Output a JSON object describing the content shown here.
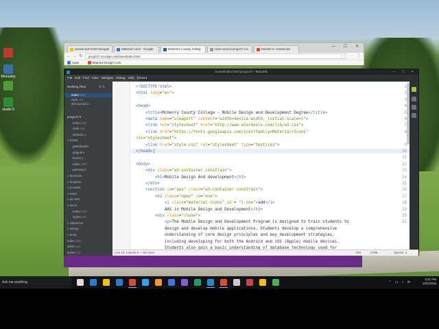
{
  "colors": {
    "accent": "#2b87d3",
    "editor_bg": "#2e3134",
    "purple_bar": "#6a2a8a"
  },
  "desktop": {
    "icons": [
      {
        "label": "",
        "color": "#c0392b"
      },
      {
        "label": "Recovery",
        "color": "#3d6ea8"
      },
      {
        "label": "",
        "color": "#4f9c38"
      },
      {
        "label": "studio 5",
        "color": "#2f8c36"
      }
    ]
  },
  "browser": {
    "tabs": [
      {
        "label": "JavaScript DOM Navigati",
        "fav": "#f2c200"
      },
      {
        "label": "Material Icons - Google",
        "fav": "#2d7bd6"
      },
      {
        "label": "McHenry County Colleg",
        "fav": "#1e5ea3",
        "active": true
      },
      {
        "label": "view-source:prog147.mc",
        "fav": "#999999"
      },
      {
        "label": "Module 5: JavaScript",
        "fav": "#e04a2e"
      }
    ],
    "address": "prog147.mccdgm.net/sixes/index.html",
    "bookmarks": [
      {
        "label": "Apps",
        "fav": "#3b78e7"
      },
      {
        "label": "Material Design Colo",
        "fav": "#e8453c"
      }
    ]
  },
  "editor": {
    "title": "boxes/index.html (prog147) - Brackets",
    "menu": [
      "File",
      "Edit",
      "Find",
      "View",
      "Navigate",
      "Debug",
      "Help",
      "Emmet"
    ],
    "sidebar": {
      "working_files_title": "Working Files",
      "working_files": [
        {
          "name": "index",
          "ext": ".html",
          "active": true
        },
        {
          "name": "style",
          "ext": ".css"
        },
        {
          "name": "demoscript",
          "ext": ".js"
        }
      ],
      "project_title": "prog147 ▾",
      "tree": [
        {
          "name": "index",
          "ext": ".html",
          "indent": 1
        },
        {
          "name": "style",
          "ext": ".css",
          "indent": 1
        },
        {
          "name": "website",
          "ext": ".js",
          "indent": 1
        },
        {
          "name": "boxes",
          "folder": "open",
          "indent": 0
        },
        {
          "name": "gitattributes",
          "ext": "",
          "indent": 1
        },
        {
          "name": "gitignore",
          "ext": "",
          "indent": 1
        },
        {
          "name": "boxes",
          "ext": ".js",
          "indent": 1
        },
        {
          "name": "index",
          "ext": ".html",
          "indent": 1
        },
        {
          "name": "painting",
          "ext": ".js",
          "indent": 1
        },
        {
          "name": "functions",
          "folder": "closed",
          "indent": 0
        },
        {
          "name": "footprint",
          "folder": "closed",
          "indent": 0
        },
        {
          "name": "js-event",
          "folder": "closed",
          "indent": 0
        },
        {
          "name": "loops",
          "folder": "closed",
          "indent": 0
        },
        {
          "name": "pic-test",
          "folder": "closed",
          "indent": 0
        },
        {
          "name": "stack",
          "folder": "open",
          "indent": 0
        },
        {
          "name": "index",
          "ext": ".html",
          "indent": 1
        },
        {
          "name": "styles",
          "ext": ".css",
          "indent": 1
        },
        {
          "name": "slideshow",
          "folder": "closed",
          "indent": 0
        },
        {
          "name": "strings",
          "folder": "closed",
          "indent": 0
        },
        {
          "name": "temp",
          "folder": "closed",
          "indent": 0
        },
        {
          "name": "index",
          "ext": ".html",
          "indent": 0
        },
        {
          "name": "styles",
          "ext": ".css",
          "indent": 0
        },
        {
          "name": "styles",
          "ext": ".css",
          "indent": 0
        },
        {
          "name": "styles",
          "ext": ".css.map",
          "indent": 0
        }
      ]
    },
    "code_lines": [
      {
        "n": "1",
        "html": "<span class='tag'>&lt;!DOCTYPE html&gt;</span>"
      },
      {
        "n": "2",
        "html": "<span class='tag'>&lt;html</span> <span class='attr'>lang</span>=<span class='val'>\"en\"</span><span class='tag'>&gt;</span>"
      },
      {
        "n": "3",
        "html": ""
      },
      {
        "n": "4",
        "html": "<span class='tag'>&lt;head&gt;</span>"
      },
      {
        "n": "5",
        "html": "    <span class='tag'>&lt;title&gt;</span>McHenry County College - Mobile Design and Development Degree<span class='tag'>&lt;/title&gt;</span>"
      },
      {
        "n": "6",
        "html": "    <span class='tag'>&lt;meta</span> <span class='attr'>name</span>=<span class='val'>\"viewport\"</span> <span class='attr'>content</span>=<span class='val'>\"width=device-width, initial-scale=1\"</span><span class='tag'>&gt;</span>"
      },
      {
        "n": "7",
        "html": "    <span class='tag'>&lt;link</span> <span class='attr'>rel</span>=<span class='val'>\"stylesheet\"</span> <span class='attr'>href</span>=<span class='val'>\"http://www.w3schools.com/lib/w3.css\"</span><span class='tag'>&gt;</span>"
      },
      {
        "n": "8",
        "html": "    <span class='tag'>&lt;link</span> <span class='attr'>href</span>=<span class='val'>\"https://fonts.googleapis.com/icon?family=Material+Icons\"</span>"
      },
      {
        "n": "",
        "html": "<span class='attr'>rel</span>=<span class='val'>\"stylesheet\"</span><span class='tag'>&gt;</span>"
      },
      {
        "n": "9",
        "html": "    <span class='tag'>&lt;link</span> <span class='attr'>href</span>=<span class='val'>\"style.css\"</span> <span class='attr'>rel</span>=<span class='val'>\"stylesheet\"</span> <span class='attr'>type</span>=<span class='val'>\"text/css\"</span><span class='tag'>&gt;</span>"
      },
      {
        "n": "10",
        "html": "<span class='tag'>&lt;/head&gt;</span>|"
      },
      {
        "n": "11",
        "html": ""
      },
      {
        "n": "12",
        "html": "<span class='tag'>&lt;body&gt;</span>"
      },
      {
        "n": "13",
        "html": "    <span class='tag'>&lt;div</span> <span class='attr'>class</span>=<span class='val'>\"w3-container constrain\"</span><span class='tag'>&gt;</span>"
      },
      {
        "n": "14",
        "html": "        <span class='tag'>&lt;h1&gt;</span>Mobile Design And development<span class='tag'>&lt;/h1&gt;</span>"
      },
      {
        "n": "15",
        "html": "    <span class='tag'>&lt;/div&gt;</span>"
      },
      {
        "n": "16",
        "html": "    <span class='tag'>&lt;section</span> <span class='attr'>id</span>=<span class='val'>\"aas\"</span> <span class='attr'>class</span>=<span class='val'>\"w3-container constrain\"</span><span class='tag'>&gt;</span>"
      },
      {
        "n": "17",
        "html": "        <span class='tag'>&lt;h2</span> <span class='attr'>class</span>=<span class='val'>\"open\"</span> <span class='attr'>id</span>=<span class='val'>\"one\"</span><span class='tag'>&gt;</span>"
      },
      {
        "n": "18",
        "html": "            <span class='tag'>&lt;i</span> <span class='attr'>class</span>=<span class='val'>\"material-icons\"</span> <span class='attr'>id</span> = <span class='val'>\"i-one\"</span><span class='tag'>&gt;</span>add<span class='tag'>&lt;/i&gt;</span>"
      },
      {
        "n": "19",
        "html": "            AAS in Mobile Design and Development<span class='tag'>&lt;/h2&gt;</span>"
      },
      {
        "n": "20",
        "html": "        <span class='tag'>&lt;div</span> <span class='attr'>class</span>=<span class='val'>\"close\"</span><span class='tag'>&gt;</span>"
      },
      {
        "n": "21",
        "html": "            <span class='tag'>&lt;p&gt;</span>The Mobile Design and Development Program is designed to train students to"
      },
      {
        "n": "",
        "html": "            design and develop mobile applications. Students develop a comprehensive"
      },
      {
        "n": "",
        "html": "            understanding of core design principles and key development strategies,"
      },
      {
        "n": "",
        "html": "            including developing for both the Android and iOS (Apple) mobile devices."
      },
      {
        "n": "",
        "html": "            Students also gain a basic understanding of database technology used for"
      }
    ],
    "status": {
      "position": "Line 10, Column 8 — 84 Lines",
      "ins": "INS",
      "lang": "HTML",
      "spaces": "Spaces: 4"
    }
  },
  "taskbar": {
    "search_placeholder": "Ask me anything",
    "time": "3:21 PM",
    "date": "10/1/2016",
    "apps": [
      {
        "name": "task-view",
        "color": "#dddddd"
      },
      {
        "name": "edge",
        "color": "#2b7bd3"
      },
      {
        "name": "file-explorer",
        "color": "#f2c200"
      },
      {
        "name": "store",
        "color": "#2b7bd3"
      },
      {
        "name": "chrome",
        "color": "#e04a2e",
        "active": true
      },
      {
        "name": "photoshop",
        "color": "#2fa3f2"
      },
      {
        "name": "illustrator",
        "color": "#f29b1d"
      },
      {
        "name": "app",
        "color": "#3b78e7"
      },
      {
        "name": "app",
        "color": "#8b5bd6"
      },
      {
        "name": "app",
        "color": "#20a060"
      },
      {
        "name": "brackets",
        "color": "#2b87d3",
        "active": true
      },
      {
        "name": "chrome",
        "color": "#e04a2e",
        "active": true
      },
      {
        "name": "app",
        "color": "#cccccc"
      },
      {
        "name": "app",
        "color": "#cc4444"
      },
      {
        "name": "app",
        "color": "#f2c200"
      },
      {
        "name": "app",
        "color": "#4caf50"
      }
    ]
  }
}
